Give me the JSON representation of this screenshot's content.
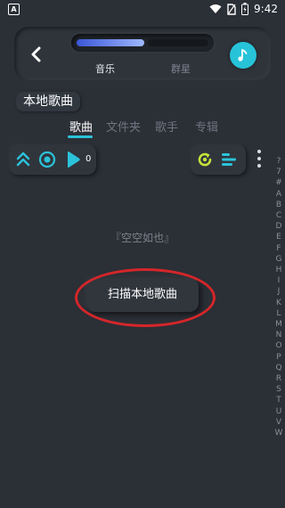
{
  "status_bar": {
    "time": "9:42",
    "left_icon_letter": "A"
  },
  "header": {
    "segments": [
      {
        "label": "音乐",
        "selected": true
      },
      {
        "label": "群星",
        "selected": false
      }
    ]
  },
  "section": {
    "title": "本地歌曲"
  },
  "tabs": [
    {
      "label": "歌曲",
      "active": true
    },
    {
      "label": "文件夹",
      "active": false
    },
    {
      "label": "歌手",
      "active": false
    },
    {
      "label": "专辑",
      "active": false
    }
  ],
  "controls": {
    "song_count": "0"
  },
  "empty_state": {
    "message": "『空空如也』"
  },
  "scan_button": {
    "label": "扫描本地歌曲"
  },
  "index_letters": [
    "?",
    "7",
    "#",
    "A",
    "B",
    "C",
    "D",
    "E",
    "F",
    "G",
    "H",
    "I",
    "J",
    "K",
    "L",
    "M",
    "N",
    "O",
    "P",
    "Q",
    "R",
    "S",
    "T",
    "U",
    "V",
    "W"
  ],
  "colors": {
    "background": "#2b2f36",
    "accent": "#2bc3d9",
    "refresh_green": "#c7e23a",
    "highlight_red": "#d4262a",
    "segment_blue": "#3b57d6"
  }
}
